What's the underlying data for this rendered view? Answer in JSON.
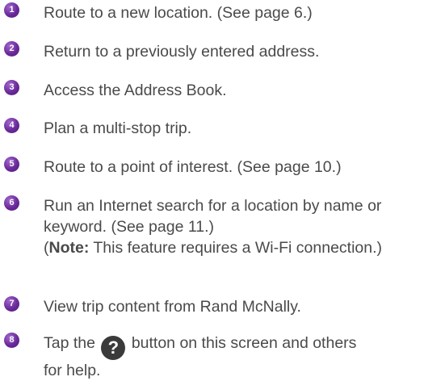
{
  "colors": {
    "badge": "#6a2a9a",
    "text": "#4a4a4a",
    "help_icon": "#3a3a3a"
  },
  "items": [
    {
      "number": "1",
      "text": "Route to a new location. (See page 6.)"
    },
    {
      "number": "2",
      "text": "Return to a previously entered address."
    },
    {
      "number": "3",
      "text": "Access the Address Book."
    },
    {
      "number": "4",
      "text": "Plan a multi-stop trip."
    },
    {
      "number": "5",
      "text": "Route to a point of interest. (See page 10.)"
    },
    {
      "number": "6",
      "line1": "Run an Internet search for a location by name or",
      "line2": "keyword. (See page 11.)",
      "note_open": "(",
      "note_label": "Note:",
      "note_text": " This feature requires a Wi-Fi connection.)"
    },
    {
      "number": "7",
      "text": "View trip content from Rand McNally."
    },
    {
      "number": "8",
      "before_icon": "Tap the",
      "icon_glyph": "?",
      "after_icon": "button on this screen and others",
      "line2": "for help."
    }
  ]
}
